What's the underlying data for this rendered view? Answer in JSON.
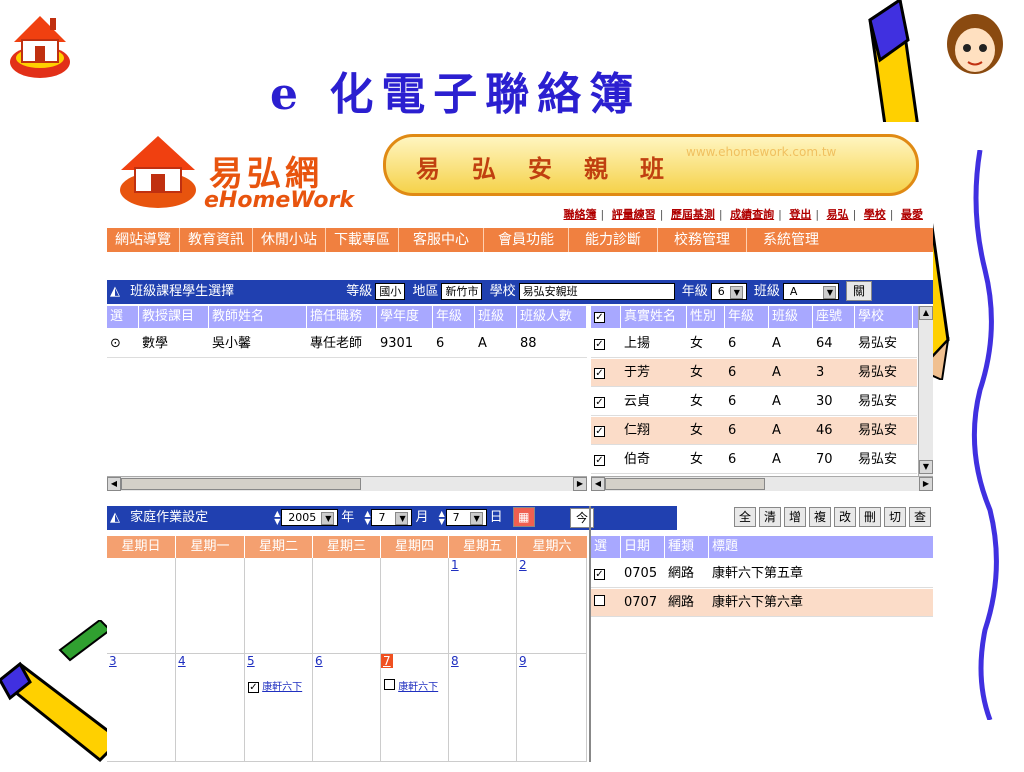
{
  "slide_title": "e 化電子聯絡簿",
  "logo": {
    "cn": "易弘網",
    "en": "eHomeWork",
    "house_text": "Home Work"
  },
  "banner": {
    "text": "易弘安親班",
    "url": "www.ehomework.com.tw"
  },
  "top_links": [
    "聯絡簿",
    "評量練習",
    "歷屆基測",
    "成績查詢",
    "登出",
    "易弘",
    "學校",
    "最愛"
  ],
  "menu": [
    "網站導覽",
    "教育資訊",
    "休閒小站",
    "下載專區",
    "客服中心",
    "會員功能",
    "能力診斷",
    "校務管理",
    "系統管理"
  ],
  "select_panel": {
    "title": "班級課程學生選擇",
    "grade_label": "等級",
    "grade_value": "國小",
    "region_label": "地區",
    "region_value": "新竹市",
    "school_label": "學校",
    "school_value": "易弘安親班",
    "year_label": "年級",
    "year_value": "6",
    "class_label": "班級",
    "class_value": "A",
    "close_label": "關"
  },
  "course_table": {
    "headers": [
      "選",
      "教授課目",
      "教師姓名",
      "擔任職務",
      "學年度",
      "年級",
      "班級",
      "班級人數"
    ],
    "rows": [
      {
        "radio": "⊙",
        "subject": "數學",
        "teacher": "吳小馨",
        "role": "專任老師",
        "year": "9301",
        "grade": "6",
        "class": "A",
        "count": "88"
      }
    ]
  },
  "student_table": {
    "headers": [
      "",
      "真實姓名",
      "性別",
      "年級",
      "班級",
      "座號",
      "學校"
    ],
    "rows": [
      {
        "check": "✓",
        "name": "上揚",
        "sex": "女",
        "grade": "6",
        "class": "A",
        "seat": "64",
        "school": "易弘安"
      },
      {
        "check": "✓",
        "name": "于芳",
        "sex": "女",
        "grade": "6",
        "class": "A",
        "seat": "3",
        "school": "易弘安"
      },
      {
        "check": "✓",
        "name": "云貞",
        "sex": "女",
        "grade": "6",
        "class": "A",
        "seat": "30",
        "school": "易弘安"
      },
      {
        "check": "✓",
        "name": "仁翔",
        "sex": "女",
        "grade": "6",
        "class": "A",
        "seat": "46",
        "school": "易弘安"
      },
      {
        "check": "✓",
        "name": "伯奇",
        "sex": "女",
        "grade": "6",
        "class": "A",
        "seat": "70",
        "school": "易弘安"
      }
    ]
  },
  "hw_panel": {
    "title": "家庭作業設定",
    "year_value": "2005",
    "year_label": "年",
    "month_value": "7",
    "month_label": "月",
    "day_value": "7",
    "day_label": "日",
    "today_label": "今"
  },
  "weekdays": [
    "星期日",
    "星期一",
    "星期二",
    "星期三",
    "星期四",
    "星期五",
    "星期六"
  ],
  "calendar": {
    "week1": [
      "",
      "",
      "",
      "",
      "",
      "1",
      "2"
    ],
    "week2": [
      "3",
      "4",
      "5",
      "6",
      "7",
      "8",
      "9"
    ],
    "hw_items": [
      {
        "label": "康軒六下",
        "checked": "✓"
      },
      {
        "label": "康軒六下",
        "checked": ""
      }
    ]
  },
  "toolbar": [
    "全",
    "清",
    "增",
    "複",
    "改",
    "刪",
    "切",
    "查"
  ],
  "hw_table": {
    "headers": [
      "選",
      "日期",
      "種類",
      "標題"
    ],
    "rows": [
      {
        "check": "✓",
        "date": "0705",
        "type": "網路",
        "title": "康軒六下第五章"
      },
      {
        "check": "",
        "date": "0707",
        "type": "網路",
        "title": "康軒六下第六章"
      }
    ]
  },
  "colors": {
    "title": "#2b1fd0",
    "menu": "#f08040",
    "panel": "#2040b0",
    "table_header": "#a8a8ff",
    "alt_row": "#fbdcc8",
    "week_header": "#f4a070"
  }
}
